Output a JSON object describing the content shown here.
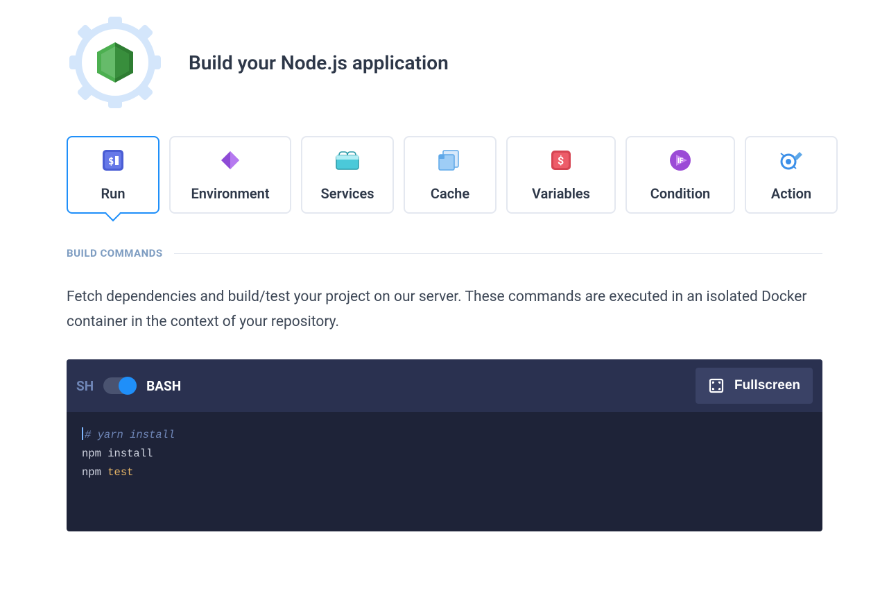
{
  "header": {
    "title": "Build your Node.js application"
  },
  "tabs": [
    {
      "id": "run",
      "label": "Run",
      "icon": "run-icon",
      "active": true
    },
    {
      "id": "environment",
      "label": "Environment",
      "icon": "environment-icon",
      "active": false
    },
    {
      "id": "services",
      "label": "Services",
      "icon": "services-icon",
      "active": false
    },
    {
      "id": "cache",
      "label": "Cache",
      "icon": "cache-icon",
      "active": false
    },
    {
      "id": "variables",
      "label": "Variables",
      "icon": "variables-icon",
      "active": false
    },
    {
      "id": "condition",
      "label": "Condition",
      "icon": "condition-icon",
      "active": false
    },
    {
      "id": "action",
      "label": "Action",
      "icon": "action-icon",
      "active": false
    }
  ],
  "section": {
    "title": "BUILD COMMANDS",
    "description": "Fetch dependencies and build/test your project on our server. These commands are executed in an isolated Docker container in the context of your repository."
  },
  "shell": {
    "sh_label": "SH",
    "bash_label": "BASH",
    "mode": "bash"
  },
  "toolbar": {
    "fullscreen_label": "Fullscreen"
  },
  "code": {
    "lines": [
      {
        "type": "comment",
        "text": "# yarn install"
      },
      {
        "type": "cmd",
        "cmd": "npm",
        "arg": "install"
      },
      {
        "type": "cmd",
        "cmd": "npm",
        "arg": "test"
      }
    ]
  }
}
